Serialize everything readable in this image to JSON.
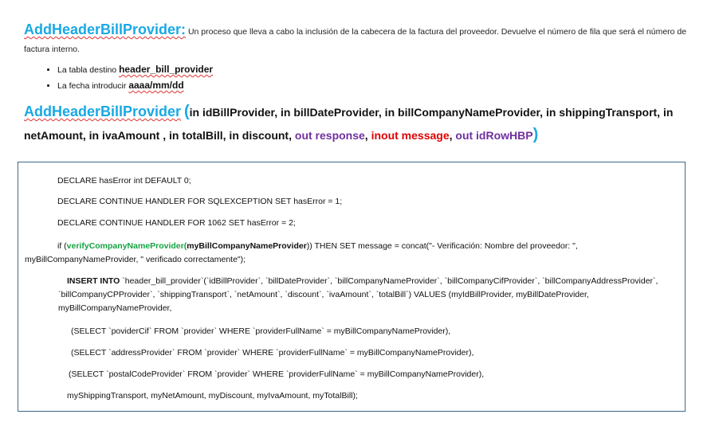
{
  "header": {
    "title": "AddHeaderBillProvider:",
    "description": "Un proceso que lleva a cabo la inclusión de la cabecera de la factura del proveedor. Devuelve el número de fila que será el número de factura interno."
  },
  "bullets": [
    {
      "label": "La tabla destino ",
      "value": "header_bill_provider"
    },
    {
      "label": "La fecha introducir ",
      "value": "aaaa/mm/dd"
    }
  ],
  "signature": {
    "name": "AddHeaderBillProvider",
    "open": "(",
    "close": ")",
    "params": [
      {
        "text": "in idBillProvider, in billDateProvider, in billCompanyNameProvider, in shippingTransport, in netAmount, in ivaAmount , in totalBill, in discount, ",
        "kind": "in"
      },
      {
        "text": "out response",
        "kind": "out"
      },
      {
        "text": ", ",
        "kind": "in"
      },
      {
        "text": "inout message",
        "kind": "inout"
      },
      {
        "text": ", ",
        "kind": "in"
      },
      {
        "text": "out idRowHBP",
        "kind": "out"
      }
    ]
  },
  "code": {
    "line1": "DECLARE hasError int DEFAULT 0;",
    "line2": "DECLARE CONTINUE HANDLER FOR SQLEXCEPTION SET hasError = 1;",
    "line3": "DECLARE CONTINUE HANDLER FOR 1062 SET hasError = 2;",
    "if_kw": "if (",
    "if_func": "verifyCompanyNameProvider(",
    "if_arg": "myBillCompanyNameProvider",
    "if_rest": ")) THEN  SET message = concat(\"- Verificación: Nombre del proveedor: \", myBillCompanyNameProvider, \" verificado correctamente\");",
    "insert_kw": "INSERT INTO",
    "insert_rest": " `header_bill_provider`(`idBillProvider`, `billDateProvider`, `billCompanyNameProvider`, `billCompanyCifProvider`, `billCompanyAddressProvider`, `billCompanyCPProvider`, `shippingTransport`, `netAmount`, `discount`, `ivaAmount`, `totalBill`) VALUES (myIdBillProvider, myBillDateProvider, myBillCompanyNameProvider,",
    "select1": "(SELECT `poviderCif` FROM `provider` WHERE `providerFullName` = myBillCompanyNameProvider),",
    "select2": "(SELECT `addressProvider` FROM `provider` WHERE `providerFullName` = myBillCompanyNameProvider),",
    "select3": "(SELECT `postalCodeProvider` FROM `provider` WHERE `providerFullName` = myBillCompanyNameProvider),",
    "last": "myShippingTransport, myNetAmount,  myDiscount, myIvaAmount, myTotalBill);"
  },
  "colors": {
    "title": "#18a9e4",
    "out_param": "#7030a0",
    "inout_param": "#e00000",
    "function_name": "#17a244",
    "box_border": "#3e6a8a"
  }
}
